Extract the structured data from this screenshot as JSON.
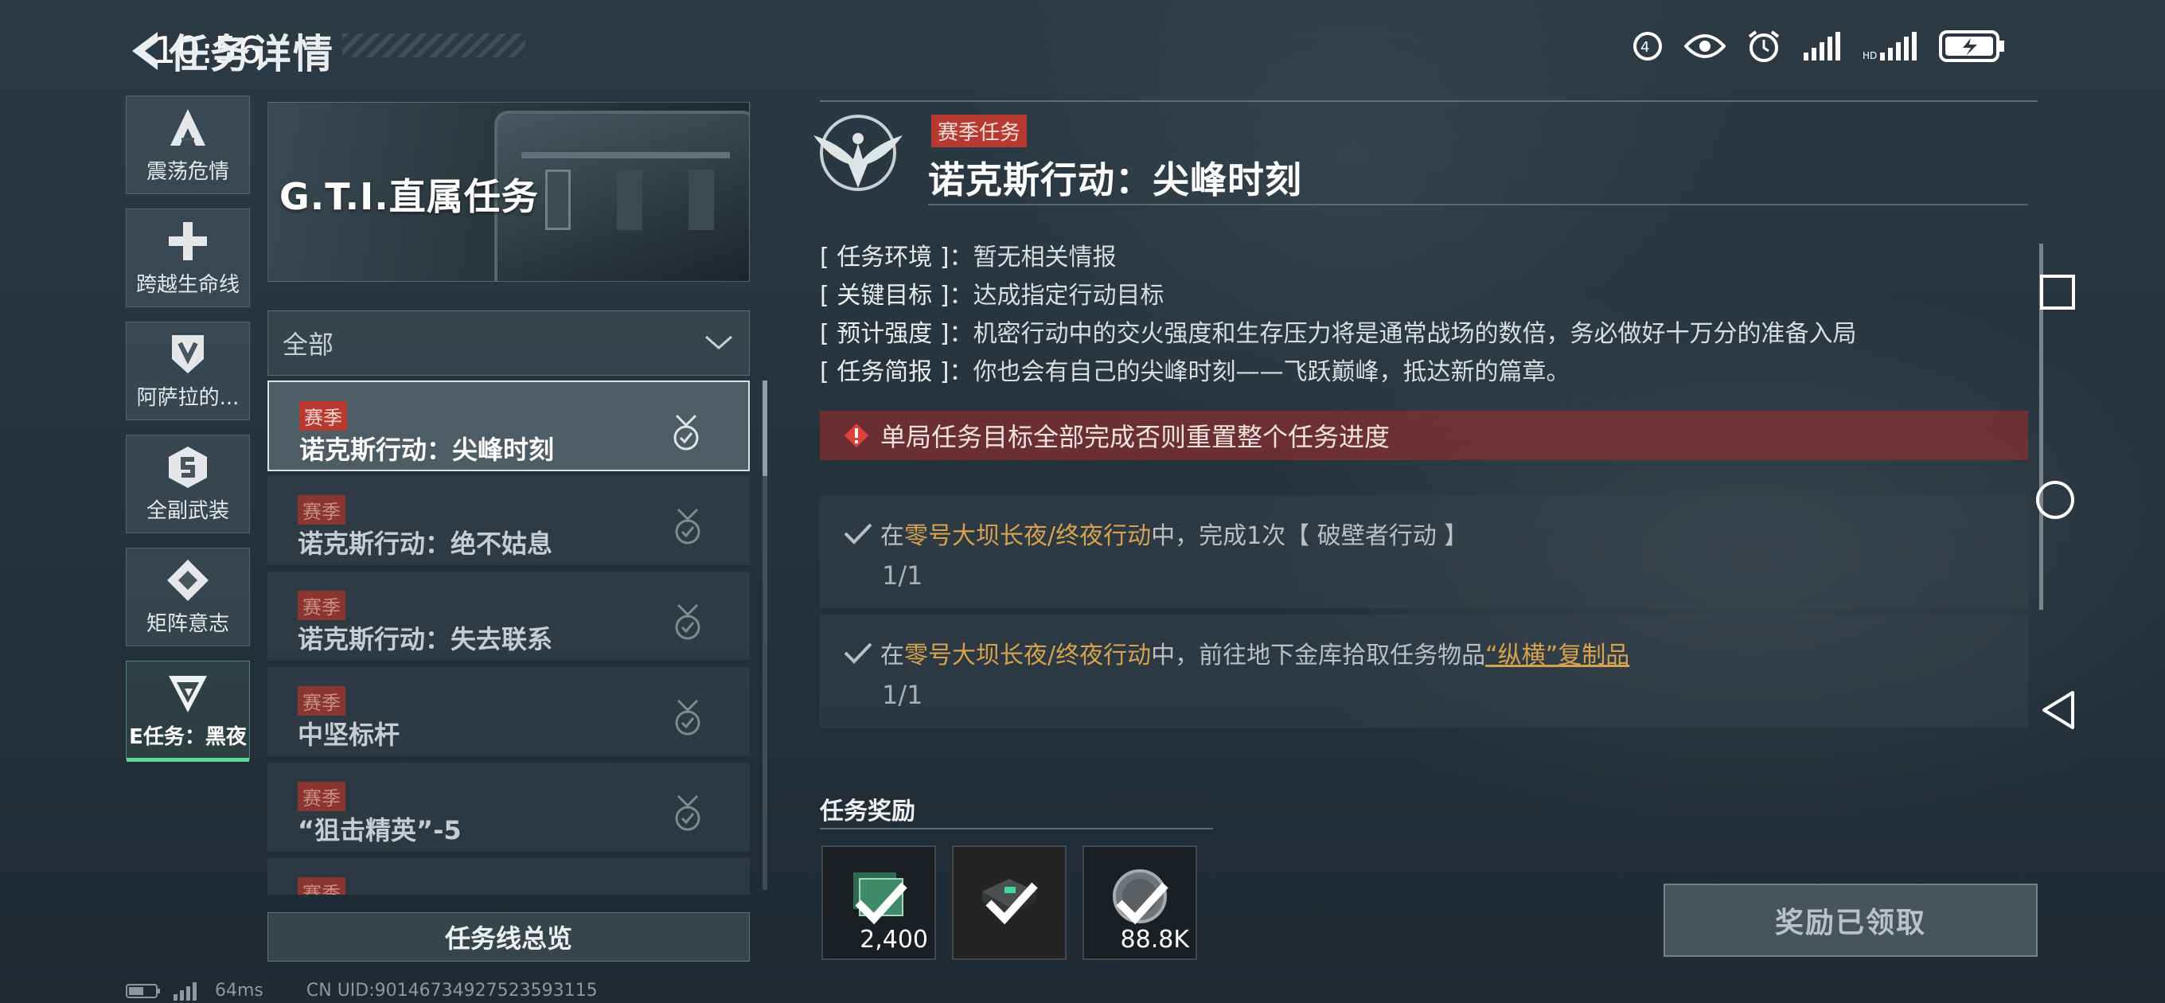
{
  "status_bar": {
    "time": "10:56"
  },
  "header": {
    "title": "任务详情"
  },
  "sidebar": {
    "items": [
      {
        "label": "震荡危情",
        "icon": "a-chevron-icon"
      },
      {
        "label": "跨越生命线",
        "icon": "cross-icon"
      },
      {
        "label": "阿萨拉的...",
        "icon": "shield-v-icon"
      },
      {
        "label": "全副武装",
        "icon": "hexagon-s-icon"
      },
      {
        "label": "矩阵意志",
        "icon": "diamond-arrows-icon"
      },
      {
        "label": "E任务：黑夜",
        "icon": "triangle-g-icon",
        "active": true
      }
    ]
  },
  "banner": {
    "title": "G.T.I.直属任务"
  },
  "filter": {
    "selected": "全部"
  },
  "tasks": [
    {
      "tag": "赛季",
      "name": "诺克斯行动：尖峰时刻",
      "selected": true
    },
    {
      "tag": "赛季",
      "name": "诺克斯行动：绝不姑息"
    },
    {
      "tag": "赛季",
      "name": "诺克斯行动：失去联系"
    },
    {
      "tag": "赛季",
      "name": "中坚标杆"
    },
    {
      "tag": "赛季",
      "name": "“狙击精英”-5"
    },
    {
      "tag": "赛季",
      "name": ""
    }
  ],
  "overview_button": "任务线总览",
  "footer": {
    "ping": "64ms",
    "uid": "CN UID:9014673492752359311​5"
  },
  "detail": {
    "tag": "赛季任务",
    "title": "诺克斯行动：尖峰时刻",
    "info": [
      {
        "key": "[ 任务环境 ]：",
        "value": "暂无相关情报"
      },
      {
        "key": "[ 关键目标 ]：",
        "value": "达成指定行动目标"
      },
      {
        "key": "[ 预计强度 ]：",
        "value": "机密行动中的交火强度和生存压力将是通常战场的数倍，务必做好十万分的准备入局"
      },
      {
        "key": "[ 任务简报 ]：",
        "value": "你也会有自己的尖峰时刻——飞跃巅峰，抵达新的篇章。"
      }
    ],
    "warning": "单局任务目标全部完成否则重置整个任务进度",
    "objectives": [
      {
        "pre": "在",
        "hl": "零号大坝长夜/终夜行动",
        "post": "中，完成1次【 破壁者行动 】",
        "ul": "",
        "progress": "1/1"
      },
      {
        "pre": "在",
        "hl": "零号大坝长夜/终夜行动",
        "post": "中，前往地下金库拾取任务物品",
        "ul": "“纵横”复制品",
        "progress": "1/1"
      }
    ],
    "rewards_title": "任务奖励",
    "rewards": [
      {
        "count": "2,400",
        "icon": "currency-icon"
      },
      {
        "count": "",
        "icon": "item-case-icon"
      },
      {
        "count": "88.8K",
        "icon": "coin-icon"
      }
    ],
    "claim_button": "奖励已领取"
  }
}
